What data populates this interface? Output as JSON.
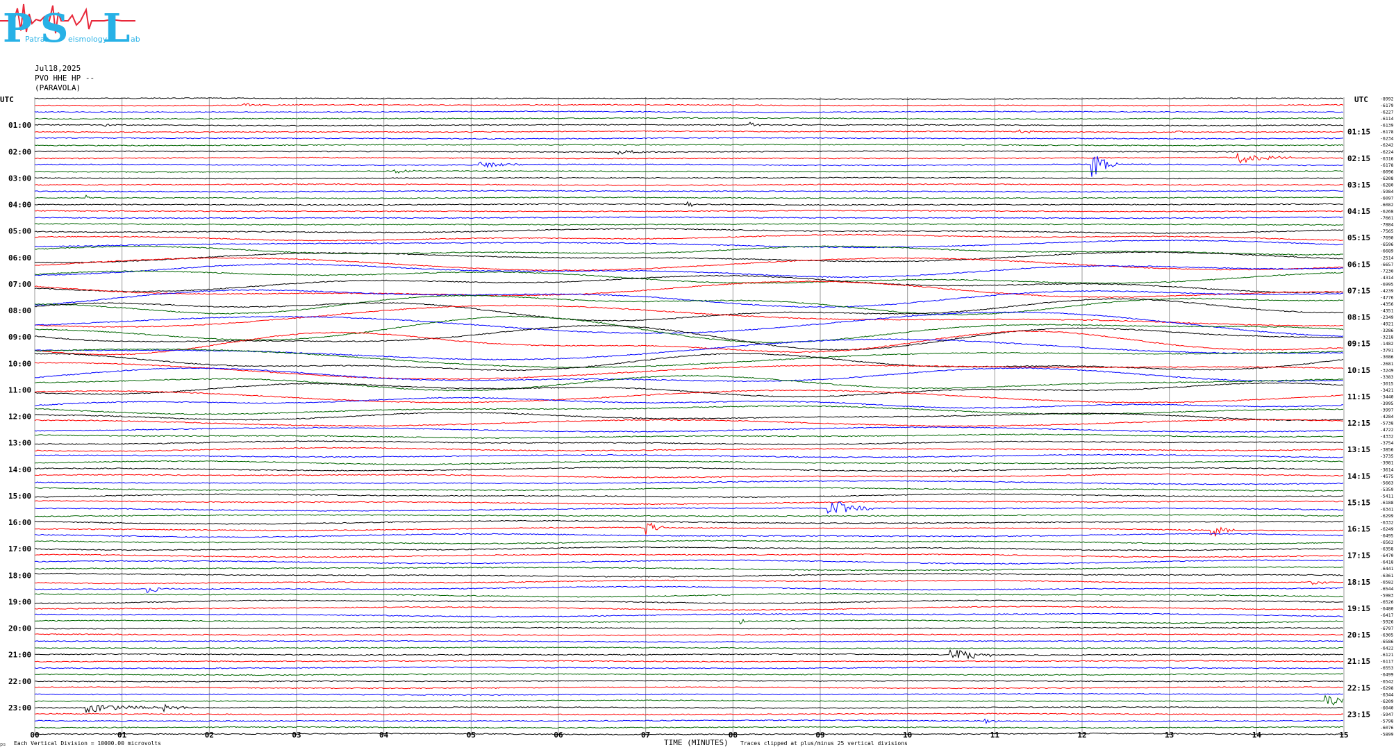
{
  "logo": {
    "letters": [
      "P",
      "S",
      "L"
    ],
    "words": [
      "Patras",
      "eismology",
      "ab"
    ]
  },
  "header": {
    "date": "Jul18,2025",
    "station": "PVO HHE HP --",
    "location": "(PARAVOLA)"
  },
  "chart_data": {
    "type": "line",
    "left_axis_title": "UTC",
    "right_axis_title": "UTC",
    "left_hours": [
      "01:00",
      "02:00",
      "03:00",
      "04:00",
      "05:00",
      "06:00",
      "07:00",
      "08:00",
      "09:00",
      "10:00",
      "11:00",
      "12:00",
      "13:00",
      "14:00",
      "15:00",
      "16:00",
      "17:00",
      "18:00",
      "19:00",
      "20:00",
      "21:00",
      "22:00",
      "23:00"
    ],
    "right_hours": [
      "01:15",
      "02:15",
      "03:15",
      "04:15",
      "05:15",
      "06:15",
      "07:15",
      "08:15",
      "09:15",
      "10:15",
      "11:15",
      "12:15",
      "13:15",
      "14:15",
      "15:15",
      "16:15",
      "17:15",
      "18:15",
      "19:15",
      "20:15",
      "21:15",
      "22:15",
      "23:15"
    ],
    "x_ticks": [
      "00",
      "01",
      "02",
      "03",
      "04",
      "05",
      "06",
      "07",
      "08",
      "09",
      "10",
      "11",
      "12",
      "13",
      "14",
      "15"
    ],
    "xlim": [
      0,
      15
    ],
    "xlabel": "TIME (MINUTES)",
    "trace_colors": [
      "#000000",
      "#ff0000",
      "#0000ff",
      "#006400"
    ],
    "grid": true,
    "offsets": [
      "-8992",
      "-6179",
      "-6227",
      "-6114",
      "-6139",
      "-6178",
      "-6234",
      "-6242",
      "-6224",
      "-6316",
      "-6178",
      "-6096",
      "-6208",
      "-6280",
      "-5984",
      "-6097",
      "-6082",
      "-6268",
      "-7661",
      "-7884",
      "-7565",
      "-7690",
      "-6596",
      "-6689",
      "-2514",
      "-6657",
      "-7230",
      "-4314",
      "-6995",
      "-4239",
      "-4776",
      "-4356",
      "-4351",
      "-2349",
      "-4921",
      "-3286",
      "-3218",
      "-1482",
      "-3791",
      "-3086",
      "-2681",
      "-3249",
      "-3383",
      "-3015",
      "-3421",
      "-3440",
      "-3995",
      "-3997",
      "-4284",
      "-5738",
      "-4722",
      "-4332",
      "-3754",
      "-3856",
      "-3735",
      "-3981",
      "-3614",
      "-4575",
      "-5663",
      "-5359",
      "-5411",
      "-6188",
      "-6341",
      "-6299",
      "-6332",
      "-6249",
      "-6495",
      "-6562",
      "-6358",
      "-6470",
      "-6418",
      "-6441",
      "-6361",
      "-6582",
      "-6544",
      "-5983",
      "-6526",
      "-6480",
      "-6417",
      "-5926",
      "-6797",
      "-6305",
      "-6586",
      "-6422",
      "-6121",
      "-6117",
      "-6553",
      "-6499",
      "-6542",
      "-6298",
      "-6344",
      "-6209",
      "-6040",
      "-5947",
      "-5798",
      "-6076",
      "-5899"
    ],
    "events": [
      {
        "row": 1,
        "minute": 2.4,
        "amp": 3,
        "len": 0.25
      },
      {
        "row": 4,
        "minute": 0.8,
        "amp": 3,
        "len": 0.1
      },
      {
        "row": 4,
        "minute": 8.2,
        "amp": 4,
        "len": 0.15
      },
      {
        "row": 5,
        "minute": 11.3,
        "amp": 3,
        "len": 0.25
      },
      {
        "row": 5,
        "minute": 13.1,
        "amp": 3,
        "len": 0.15
      },
      {
        "row": 8,
        "minute": 6.7,
        "amp": 4,
        "len": 0.4
      },
      {
        "row": 8,
        "minute": 15.0,
        "amp": 3,
        "len": 0.05
      },
      {
        "row": 9,
        "minute": 13.8,
        "amp": 9,
        "len": 0.6
      },
      {
        "row": 10,
        "minute": 5.1,
        "amp": 6,
        "len": 0.5
      },
      {
        "row": 10,
        "minute": 12.1,
        "amp": 22,
        "len": 0.3
      },
      {
        "row": 11,
        "minute": 4.1,
        "amp": 4,
        "len": 0.3
      },
      {
        "row": 15,
        "minute": 0.6,
        "amp": 5,
        "len": 0.05
      },
      {
        "row": 16,
        "minute": 7.5,
        "amp": 3,
        "len": 0.2
      },
      {
        "row": 56,
        "minute": 10.5,
        "amp": 4,
        "len": 0.2
      },
      {
        "row": 62,
        "minute": 9.1,
        "amp": 14,
        "len": 0.5
      },
      {
        "row": 65,
        "minute": 7.0,
        "amp": 16,
        "len": 0.2
      },
      {
        "row": 65,
        "minute": 13.5,
        "amp": 10,
        "len": 0.3
      },
      {
        "row": 73,
        "minute": 14.6,
        "amp": 5,
        "len": 0.4
      },
      {
        "row": 74,
        "minute": 1.3,
        "amp": 6,
        "len": 0.3
      },
      {
        "row": 79,
        "minute": 8.1,
        "amp": 4,
        "len": 0.1
      },
      {
        "row": 84,
        "minute": 10.5,
        "amp": 13,
        "len": 0.5
      },
      {
        "row": 89,
        "minute": 5.3,
        "amp": 3,
        "len": 0.1
      },
      {
        "row": 92,
        "minute": 0.6,
        "amp": 7,
        "len": 0.9
      },
      {
        "row": 92,
        "minute": 1.5,
        "amp": 6,
        "len": 0.3
      },
      {
        "row": 91,
        "minute": 14.8,
        "amp": 8,
        "len": 0.4
      },
      {
        "row": 94,
        "minute": 10.9,
        "amp": 4,
        "len": 0.2
      }
    ]
  },
  "footer": {
    "scale_note": "Each Vertical Division = 10000.00 microvolts",
    "clip_note": "Traces clipped at plus/minus 25 vertical divisions",
    "corner_mark": "ps"
  }
}
